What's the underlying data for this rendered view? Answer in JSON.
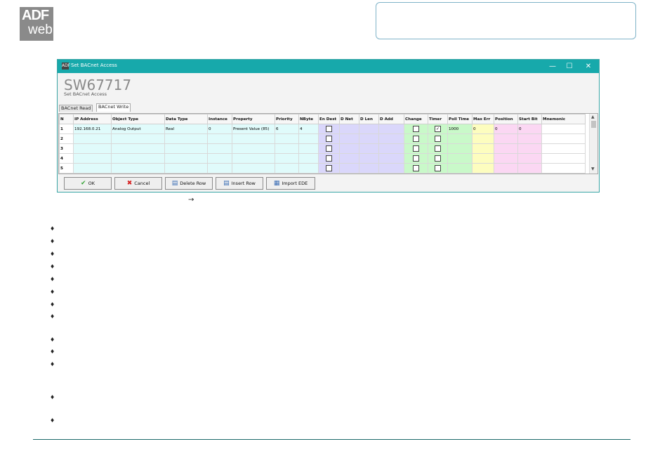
{
  "logo": {
    "line1": "ADF",
    "line2": "web"
  },
  "window": {
    "title": "Set BACnet Access",
    "app_icon": "ADF",
    "minimize": "—",
    "maximize": "☐",
    "close": "✕",
    "product": "SW67717",
    "subtitle": "Set BACnet Access"
  },
  "tabs": [
    {
      "label": "BACnet Read",
      "active": false
    },
    {
      "label": "BACnet Write",
      "active": true
    }
  ],
  "table": {
    "headers": [
      "N",
      "IP Address",
      "Object Type",
      "Data Type",
      "Instance",
      "Property",
      "Priority",
      "NByte",
      "En Dest",
      "D Net",
      "D Len",
      "D Add",
      "Change",
      "Timer",
      "Poll Time",
      "Max Err",
      "Position",
      "Start Bit",
      "Mnemonic"
    ],
    "rows": [
      {
        "n": "1",
        "ip": "192.168.0.21",
        "object_type": "Analog Output",
        "data_type": "Real",
        "instance": "0",
        "property": "Present Value (85)",
        "priority": "6",
        "nbyte": "4",
        "en_dest": false,
        "d_net": "",
        "d_len": "",
        "d_add": "",
        "change": false,
        "timer": true,
        "poll_time": "1000",
        "max_err": "0",
        "position": "0",
        "start_bit": "0",
        "mnemonic": ""
      },
      {
        "n": "2",
        "ip": "",
        "object_type": "",
        "data_type": "",
        "instance": "",
        "property": "",
        "priority": "",
        "nbyte": "",
        "en_dest": false,
        "d_net": "",
        "d_len": "",
        "d_add": "",
        "change": false,
        "timer": false,
        "poll_time": "",
        "max_err": "",
        "position": "",
        "start_bit": "",
        "mnemonic": ""
      },
      {
        "n": "3",
        "ip": "",
        "object_type": "",
        "data_type": "",
        "instance": "",
        "property": "",
        "priority": "",
        "nbyte": "",
        "en_dest": false,
        "d_net": "",
        "d_len": "",
        "d_add": "",
        "change": false,
        "timer": false,
        "poll_time": "",
        "max_err": "",
        "position": "",
        "start_bit": "",
        "mnemonic": ""
      },
      {
        "n": "4",
        "ip": "",
        "object_type": "",
        "data_type": "",
        "instance": "",
        "property": "",
        "priority": "",
        "nbyte": "",
        "en_dest": false,
        "d_net": "",
        "d_len": "",
        "d_add": "",
        "change": false,
        "timer": false,
        "poll_time": "",
        "max_err": "",
        "position": "",
        "start_bit": "",
        "mnemonic": ""
      },
      {
        "n": "5",
        "ip": "",
        "object_type": "",
        "data_type": "",
        "instance": "",
        "property": "",
        "priority": "",
        "nbyte": "",
        "en_dest": false,
        "d_net": "",
        "d_len": "",
        "d_add": "",
        "change": false,
        "timer": false,
        "poll_time": "",
        "max_err": "",
        "position": "",
        "start_bit": "",
        "mnemonic": ""
      }
    ]
  },
  "buttons": {
    "ok": {
      "label": "OK",
      "icon": "check-icon"
    },
    "cancel": {
      "label": "Cancel",
      "icon": "cross-icon"
    },
    "delete_row": {
      "label": "Delete Row",
      "icon": "delete-row-icon"
    },
    "insert_row": {
      "label": "Insert Row",
      "icon": "insert-row-icon"
    },
    "import_ede": {
      "label": "Import EDE",
      "icon": "import-icon"
    }
  },
  "arrow_glyph": "→",
  "bullet_glyph": "♦",
  "colors": {
    "titlebar": "#17a9ab",
    "col_cyan": "#e0fbfb",
    "col_purple": "#dad7fb",
    "col_green": "#c9f9c9",
    "col_yellow": "#fdfdbf",
    "col_pink": "#fbd7f3"
  }
}
